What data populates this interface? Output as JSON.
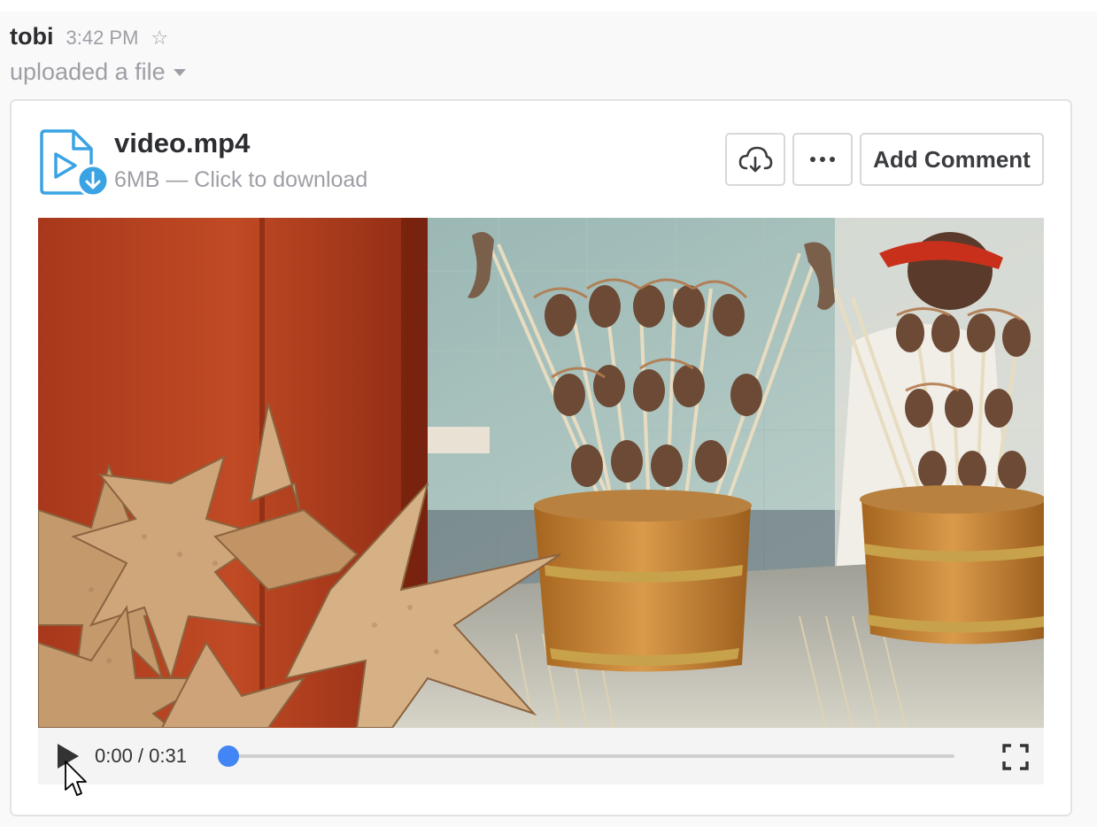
{
  "message": {
    "sender": "tobi",
    "time": "3:42 PM",
    "action": "uploaded a file"
  },
  "file": {
    "name": "video.mp4",
    "meta": "6MB — Click to download",
    "add_comment_label": "Add Comment"
  },
  "player": {
    "timecode": "0:00 / 0:31",
    "progress": 0
  },
  "icons": {
    "star": "star-outline-icon",
    "file_type": "video-file-icon",
    "download": "cloud-download-icon",
    "more": "more-horizontal-icon",
    "play": "play-icon",
    "fullscreen": "fullscreen-icon"
  },
  "colors": {
    "accent_blue": "#3aa3e3",
    "player_progress": "#4285f4",
    "muted_text": "#9e9ea6"
  }
}
